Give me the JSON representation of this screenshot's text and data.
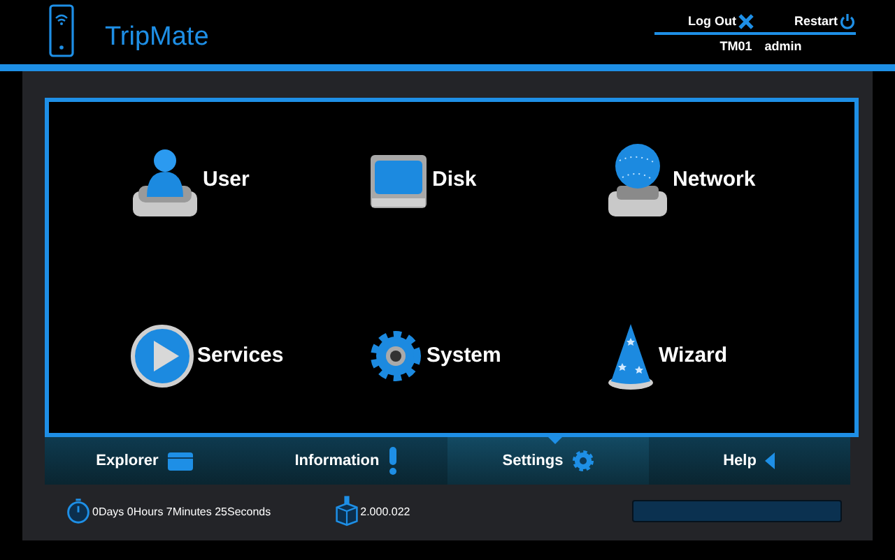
{
  "header": {
    "title": "TripMate",
    "logout": "Log Out",
    "restart": "Restart",
    "device": "TM01",
    "user": "admin"
  },
  "tiles": [
    {
      "label": "User",
      "kind": "user"
    },
    {
      "label": "Disk",
      "kind": "disk"
    },
    {
      "label": "Network",
      "kind": "network"
    },
    {
      "label": "Services",
      "kind": "services"
    },
    {
      "label": "System",
      "kind": "system"
    },
    {
      "label": "Wizard",
      "kind": "wizard"
    }
  ],
  "nav": [
    {
      "label": "Explorer",
      "kind": "explorer",
      "selected": false
    },
    {
      "label": "Information",
      "kind": "information",
      "selected": false
    },
    {
      "label": "Settings",
      "kind": "settings",
      "selected": true
    },
    {
      "label": "Help",
      "kind": "help",
      "selected": false
    }
  ],
  "status": {
    "uptime": "0Days 0Hours 7Minutes 25Seconds",
    "version": "2.000.022"
  }
}
